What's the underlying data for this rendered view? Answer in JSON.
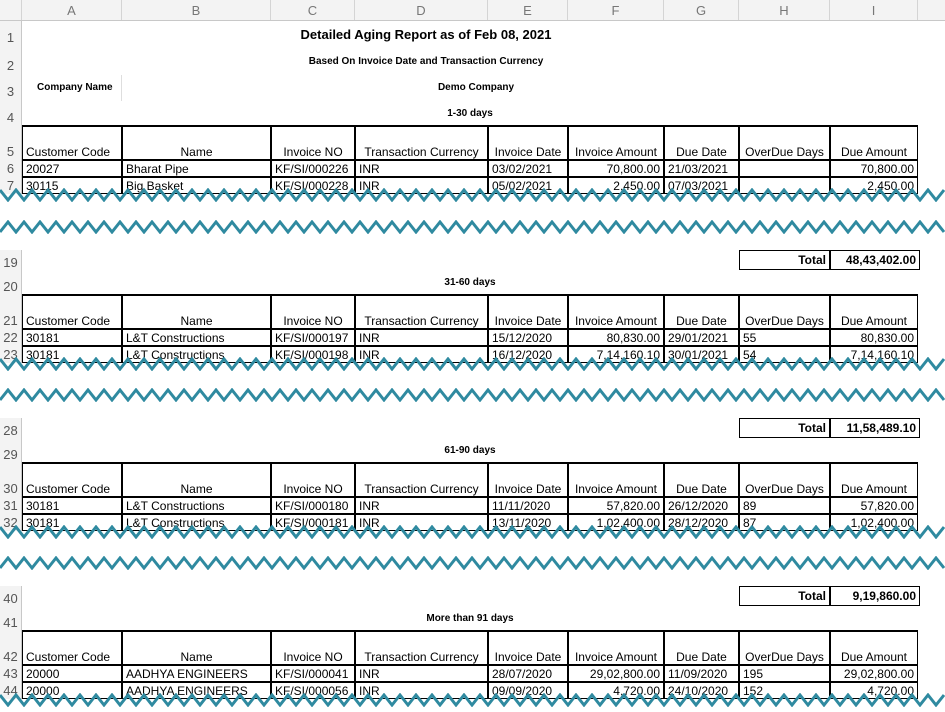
{
  "columns": [
    "A",
    "B",
    "C",
    "D",
    "E",
    "F",
    "G",
    "H",
    "I"
  ],
  "report": {
    "title": "Detailed Aging Report as of Feb 08, 2021",
    "subtitle": "Based On Invoice Date and Transaction Currency",
    "company_label": "Company Name",
    "company_value": "Demo Company"
  },
  "headers": [
    "Customer Code",
    "Name",
    "Invoice NO",
    "Transaction Currency",
    "Invoice Date",
    "Invoice Amount",
    "Due Date",
    "OverDue Days",
    "Due Amount"
  ],
  "sections": [
    {
      "label": "1-30 days",
      "label_row": "4",
      "header_row": "5",
      "rows": [
        {
          "n": "6",
          "cells": [
            "20027",
            "Bharat Pipe",
            "KF/SI/000226",
            "INR",
            "03/02/2021",
            "70,800.00",
            "21/03/2021",
            "",
            "70,800.00"
          ]
        },
        {
          "n": "7",
          "cells": [
            "30115",
            "Big Basket",
            "KF/SI/000228",
            "INR",
            "05/02/2021",
            "2,450.00",
            "07/03/2021",
            "",
            "2,450.00"
          ]
        }
      ]
    },
    {
      "label": "31-60 days",
      "label_row": "20",
      "header_row": "21",
      "total_row": "19",
      "prev_total": "48,43,402.00",
      "rows": [
        {
          "n": "22",
          "cells": [
            "30181",
            "L&T Constructions",
            "KF/SI/000197",
            "INR",
            "15/12/2020",
            "80,830.00",
            "29/01/2021",
            "55",
            "80,830.00"
          ]
        },
        {
          "n": "23",
          "cells": [
            "30181",
            "L&T Constructions",
            "KF/SI/000198",
            "INR",
            "16/12/2020",
            "7,14,160.10",
            "30/01/2021",
            "54",
            "7,14,160.10"
          ]
        }
      ]
    },
    {
      "label": "61-90 days",
      "label_row": "29",
      "header_row": "30",
      "total_row": "28",
      "prev_total": "11,58,489.10",
      "rows": [
        {
          "n": "31",
          "cells": [
            "30181",
            "L&T Constructions",
            "KF/SI/000180",
            "INR",
            "11/11/2020",
            "57,820.00",
            "26/12/2020",
            "89",
            "57,820.00"
          ]
        },
        {
          "n": "32",
          "cells": [
            "30181",
            "L&T Constructions",
            "KF/SI/000181",
            "INR",
            "13/11/2020",
            "1,02,400.00",
            "28/12/2020",
            "87",
            "1,02,400.00"
          ]
        }
      ]
    },
    {
      "label": "More than 91 days",
      "label_row": "41",
      "header_row": "42",
      "total_row": "40",
      "prev_total": "9,19,860.00",
      "rows": [
        {
          "n": "43",
          "cells": [
            "20000",
            "AADHYA ENGINEERS",
            "KF/SI/000041",
            "INR",
            "28/07/2020",
            "29,02,800.00",
            "11/09/2020",
            "195",
            "29,02,800.00"
          ]
        },
        {
          "n": "44",
          "cells": [
            "20000",
            "AADHYA ENGINEERS",
            "KF/SI/000056",
            "INR",
            "09/09/2020",
            "4,720.00",
            "24/10/2020",
            "152",
            "4,720.00"
          ]
        }
      ]
    }
  ],
  "total_label": "Total",
  "top_rows": [
    "1",
    "2",
    "3"
  ],
  "colors": {
    "tear_stroke": "#2f8aa0",
    "header_bg": "#f3f3f3"
  }
}
